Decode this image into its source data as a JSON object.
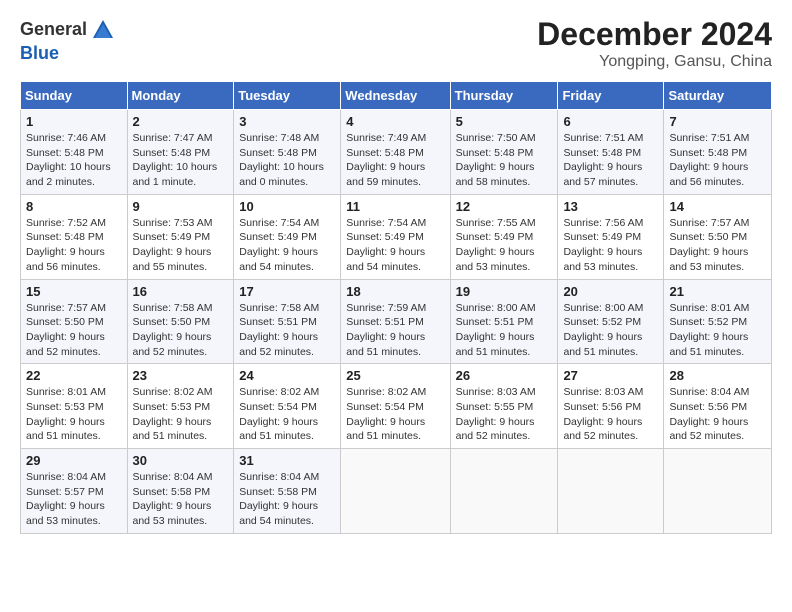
{
  "header": {
    "logo_line1": "General",
    "logo_line2": "Blue",
    "month_title": "December 2024",
    "location": "Yongping, Gansu, China"
  },
  "days_of_week": [
    "Sunday",
    "Monday",
    "Tuesday",
    "Wednesday",
    "Thursday",
    "Friday",
    "Saturday"
  ],
  "weeks": [
    [
      {
        "day": "1",
        "info": "Sunrise: 7:46 AM\nSunset: 5:48 PM\nDaylight: 10 hours\nand 2 minutes."
      },
      {
        "day": "2",
        "info": "Sunrise: 7:47 AM\nSunset: 5:48 PM\nDaylight: 10 hours\nand 1 minute."
      },
      {
        "day": "3",
        "info": "Sunrise: 7:48 AM\nSunset: 5:48 PM\nDaylight: 10 hours\nand 0 minutes."
      },
      {
        "day": "4",
        "info": "Sunrise: 7:49 AM\nSunset: 5:48 PM\nDaylight: 9 hours\nand 59 minutes."
      },
      {
        "day": "5",
        "info": "Sunrise: 7:50 AM\nSunset: 5:48 PM\nDaylight: 9 hours\nand 58 minutes."
      },
      {
        "day": "6",
        "info": "Sunrise: 7:51 AM\nSunset: 5:48 PM\nDaylight: 9 hours\nand 57 minutes."
      },
      {
        "day": "7",
        "info": "Sunrise: 7:51 AM\nSunset: 5:48 PM\nDaylight: 9 hours\nand 56 minutes."
      }
    ],
    [
      {
        "day": "8",
        "info": "Sunrise: 7:52 AM\nSunset: 5:48 PM\nDaylight: 9 hours\nand 56 minutes."
      },
      {
        "day": "9",
        "info": "Sunrise: 7:53 AM\nSunset: 5:49 PM\nDaylight: 9 hours\nand 55 minutes."
      },
      {
        "day": "10",
        "info": "Sunrise: 7:54 AM\nSunset: 5:49 PM\nDaylight: 9 hours\nand 54 minutes."
      },
      {
        "day": "11",
        "info": "Sunrise: 7:54 AM\nSunset: 5:49 PM\nDaylight: 9 hours\nand 54 minutes."
      },
      {
        "day": "12",
        "info": "Sunrise: 7:55 AM\nSunset: 5:49 PM\nDaylight: 9 hours\nand 53 minutes."
      },
      {
        "day": "13",
        "info": "Sunrise: 7:56 AM\nSunset: 5:49 PM\nDaylight: 9 hours\nand 53 minutes."
      },
      {
        "day": "14",
        "info": "Sunrise: 7:57 AM\nSunset: 5:50 PM\nDaylight: 9 hours\nand 53 minutes."
      }
    ],
    [
      {
        "day": "15",
        "info": "Sunrise: 7:57 AM\nSunset: 5:50 PM\nDaylight: 9 hours\nand 52 minutes."
      },
      {
        "day": "16",
        "info": "Sunrise: 7:58 AM\nSunset: 5:50 PM\nDaylight: 9 hours\nand 52 minutes."
      },
      {
        "day": "17",
        "info": "Sunrise: 7:58 AM\nSunset: 5:51 PM\nDaylight: 9 hours\nand 52 minutes."
      },
      {
        "day": "18",
        "info": "Sunrise: 7:59 AM\nSunset: 5:51 PM\nDaylight: 9 hours\nand 51 minutes."
      },
      {
        "day": "19",
        "info": "Sunrise: 8:00 AM\nSunset: 5:51 PM\nDaylight: 9 hours\nand 51 minutes."
      },
      {
        "day": "20",
        "info": "Sunrise: 8:00 AM\nSunset: 5:52 PM\nDaylight: 9 hours\nand 51 minutes."
      },
      {
        "day": "21",
        "info": "Sunrise: 8:01 AM\nSunset: 5:52 PM\nDaylight: 9 hours\nand 51 minutes."
      }
    ],
    [
      {
        "day": "22",
        "info": "Sunrise: 8:01 AM\nSunset: 5:53 PM\nDaylight: 9 hours\nand 51 minutes."
      },
      {
        "day": "23",
        "info": "Sunrise: 8:02 AM\nSunset: 5:53 PM\nDaylight: 9 hours\nand 51 minutes."
      },
      {
        "day": "24",
        "info": "Sunrise: 8:02 AM\nSunset: 5:54 PM\nDaylight: 9 hours\nand 51 minutes."
      },
      {
        "day": "25",
        "info": "Sunrise: 8:02 AM\nSunset: 5:54 PM\nDaylight: 9 hours\nand 51 minutes."
      },
      {
        "day": "26",
        "info": "Sunrise: 8:03 AM\nSunset: 5:55 PM\nDaylight: 9 hours\nand 52 minutes."
      },
      {
        "day": "27",
        "info": "Sunrise: 8:03 AM\nSunset: 5:56 PM\nDaylight: 9 hours\nand 52 minutes."
      },
      {
        "day": "28",
        "info": "Sunrise: 8:04 AM\nSunset: 5:56 PM\nDaylight: 9 hours\nand 52 minutes."
      }
    ],
    [
      {
        "day": "29",
        "info": "Sunrise: 8:04 AM\nSunset: 5:57 PM\nDaylight: 9 hours\nand 53 minutes."
      },
      {
        "day": "30",
        "info": "Sunrise: 8:04 AM\nSunset: 5:58 PM\nDaylight: 9 hours\nand 53 minutes."
      },
      {
        "day": "31",
        "info": "Sunrise: 8:04 AM\nSunset: 5:58 PM\nDaylight: 9 hours\nand 54 minutes."
      },
      {
        "day": "",
        "info": ""
      },
      {
        "day": "",
        "info": ""
      },
      {
        "day": "",
        "info": ""
      },
      {
        "day": "",
        "info": ""
      }
    ]
  ]
}
